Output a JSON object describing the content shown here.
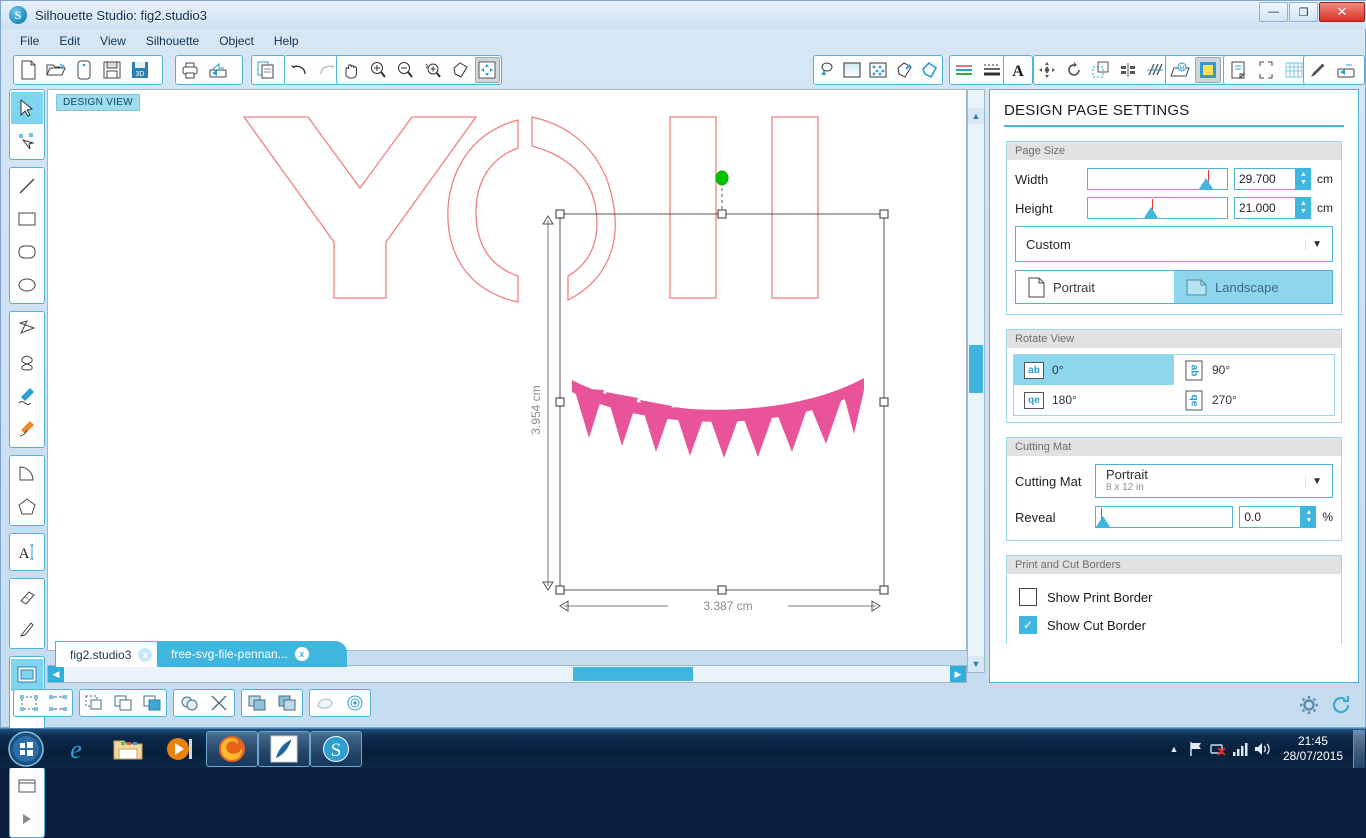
{
  "window": {
    "title": "Silhouette Studio: fig2.studio3",
    "logo_letter": "S",
    "minimize": "—",
    "maximize": "❐",
    "close": "✕"
  },
  "menubar": {
    "items": [
      {
        "label": "File"
      },
      {
        "label": "Edit"
      },
      {
        "label": "View"
      },
      {
        "label": "Silhouette"
      },
      {
        "label": "Object"
      },
      {
        "label": "Help"
      }
    ]
  },
  "toolbar": {
    "groups": [
      {
        "name": "file-group",
        "buttons": [
          {
            "icon": "new-document-icon"
          },
          {
            "icon": "open-folder-icon"
          },
          {
            "icon": "open-recent-icon"
          },
          {
            "icon": "save-icon"
          },
          {
            "icon": "save-to-library-icon"
          }
        ]
      },
      {
        "name": "print-group",
        "buttons": [
          {
            "icon": "print-icon"
          },
          {
            "icon": "send-to-silhouette-icon"
          }
        ]
      },
      {
        "name": "clipboard-group",
        "buttons": [
          {
            "icon": "copy-icon"
          },
          {
            "icon": "paste-icon"
          },
          {
            "icon": "cut-scissors-icon"
          }
        ]
      },
      {
        "name": "undo-group",
        "buttons": [
          {
            "icon": "undo-icon"
          },
          {
            "icon": "redo-icon"
          }
        ]
      },
      {
        "name": "view-group",
        "buttons": [
          {
            "icon": "pan-hand-icon"
          },
          {
            "icon": "zoom-in-icon"
          },
          {
            "icon": "zoom-out-icon"
          },
          {
            "icon": "zoom-selection-icon"
          },
          {
            "icon": "zoom-region-icon"
          },
          {
            "icon": "fit-to-window-icon"
          }
        ]
      },
      {
        "name": "panel-group-1",
        "buttons": [
          {
            "icon": "fill-color-icon"
          },
          {
            "icon": "gradient-fill-icon"
          },
          {
            "icon": "pattern-fill-icon"
          },
          {
            "icon": "line-color-icon"
          },
          {
            "icon": "line-style-icon"
          }
        ]
      },
      {
        "name": "panel-group-2",
        "buttons": [
          {
            "icon": "sketch-pens-icon"
          },
          {
            "icon": "line-thickness-icon"
          }
        ]
      },
      {
        "name": "text-group",
        "buttons": [
          {
            "icon": "text-style-icon"
          }
        ]
      },
      {
        "name": "transform-group",
        "buttons": [
          {
            "icon": "transform-icon"
          },
          {
            "icon": "rotate-icon"
          },
          {
            "icon": "scale-icon"
          },
          {
            "icon": "align-icon"
          },
          {
            "icon": "replicate-icon"
          }
        ]
      },
      {
        "name": "modify-group",
        "buttons": [
          {
            "icon": "mat-settings-icon"
          },
          {
            "icon": "cut-settings-icon"
          }
        ]
      },
      {
        "name": "page-group",
        "buttons": [
          {
            "icon": "design-page-settings-icon"
          },
          {
            "icon": "registration-marks-icon"
          },
          {
            "icon": "grid-icon"
          }
        ]
      },
      {
        "name": "send-group",
        "buttons": [
          {
            "icon": "pen-holder-icon"
          },
          {
            "icon": "send-icon"
          }
        ]
      }
    ]
  },
  "left_rail": {
    "groups": [
      {
        "tools": [
          {
            "icon": "select-arrow-icon",
            "selected": true
          },
          {
            "icon": "edit-points-icon",
            "selected": false
          }
        ]
      },
      {
        "tools": [
          {
            "icon": "line-tool-icon",
            "selected": false
          },
          {
            "icon": "rectangle-tool-icon",
            "selected": false
          },
          {
            "icon": "rounded-rectangle-tool-icon",
            "selected": false
          },
          {
            "icon": "ellipse-tool-icon",
            "selected": false
          }
        ]
      },
      {
        "tools": [
          {
            "icon": "polygon-tool-icon",
            "selected": false
          },
          {
            "icon": "curve-tool-icon",
            "selected": false
          },
          {
            "icon": "draw-freehand-icon",
            "selected": false
          },
          {
            "icon": "draw-smooth-icon",
            "selected": false
          }
        ]
      },
      {
        "tools": [
          {
            "icon": "arc-tool-icon",
            "selected": false
          },
          {
            "icon": "regular-polygon-tool-icon",
            "selected": false
          }
        ]
      },
      {
        "tools": [
          {
            "icon": "text-tool-icon",
            "selected": false
          }
        ]
      },
      {
        "tools": [
          {
            "icon": "eraser-tool-icon",
            "selected": false
          },
          {
            "icon": "knife-tool-icon",
            "selected": false
          }
        ]
      },
      {
        "tools": [
          {
            "icon": "design-page-icon",
            "selected": true
          },
          {
            "icon": "library-icon",
            "selected": false
          },
          {
            "icon": "store-icon",
            "selected": false
          }
        ]
      },
      {
        "tools": [
          {
            "icon": "panel-toggle-icon",
            "selected": false
          },
          {
            "icon": "expand-arrow-icon",
            "selected": false
          }
        ]
      }
    ]
  },
  "canvas": {
    "badge": "DESIGN VIEW",
    "letters": "YOU",
    "selection": {
      "height_label": "3.954 cm",
      "width_label": "3.387 cm"
    },
    "shape_color": "#e8748a",
    "pennant_color": "#e8539a",
    "rotate_handle_color": "#00c400"
  },
  "tabs": {
    "items": [
      {
        "label": "fig2.studio3",
        "active": true,
        "close": "x"
      },
      {
        "label": "free-svg-file-pennan...",
        "active": false,
        "close": "x"
      }
    ]
  },
  "bottom_toolbar": {
    "groups": [
      {
        "buttons": [
          {
            "icon": "group-icon"
          },
          {
            "icon": "ungroup-icon"
          }
        ]
      },
      {
        "buttons": [
          {
            "icon": "make-compound-path-icon"
          },
          {
            "icon": "bring-to-front-icon"
          },
          {
            "icon": "send-to-back-icon"
          }
        ]
      },
      {
        "buttons": [
          {
            "icon": "weld-icon"
          },
          {
            "icon": "detach-lines-icon"
          }
        ]
      },
      {
        "buttons": [
          {
            "icon": "duplicate-icon"
          },
          {
            "icon": "replicate-icon"
          }
        ]
      },
      {
        "buttons": [
          {
            "icon": "offset-icon"
          },
          {
            "icon": "internal-offset-icon"
          }
        ]
      }
    ],
    "right_buttons": [
      {
        "icon": "settings-gear-icon"
      },
      {
        "icon": "sync-refresh-icon"
      }
    ]
  },
  "panel": {
    "title": "DESIGN PAGE SETTINGS",
    "page_size": {
      "section_label": "Page Size",
      "width_label": "Width",
      "width_value": "29.700",
      "width_unit": "cm",
      "height_label": "Height",
      "height_value": "21.000",
      "height_unit": "cm",
      "preset": "Custom",
      "orientation": {
        "portrait": "Portrait",
        "landscape": "Landscape",
        "selected": "Landscape"
      }
    },
    "rotate_view": {
      "section_label": "Rotate View",
      "options": [
        {
          "label": "0°",
          "glyph": "ab",
          "selected": true
        },
        {
          "label": "90°",
          "glyph": "ab",
          "selected": false
        },
        {
          "label": "180°",
          "glyph": "qe",
          "selected": false
        },
        {
          "label": "270°",
          "glyph": "qe",
          "selected": false
        }
      ]
    },
    "cutting_mat": {
      "section_label": "Cutting Mat",
      "label": "Cutting Mat",
      "value": "Portrait",
      "value_sub": "8 x 12 in",
      "reveal_label": "Reveal",
      "reveal_value": "0.0",
      "reveal_unit": "%"
    },
    "print_cut": {
      "section_label": "Print and Cut Borders",
      "show_print_border": {
        "label": "Show Print Border",
        "checked": false
      },
      "show_cut_border": {
        "label": "Show Cut Border",
        "checked": true,
        "check": "✓"
      }
    }
  },
  "taskbar": {
    "start": "start-orb-icon",
    "items": [
      {
        "icon": "internet-explorer-icon",
        "pinned": false
      },
      {
        "icon": "file-explorer-icon",
        "pinned": false
      },
      {
        "icon": "media-player-icon",
        "pinned": false
      },
      {
        "icon": "firefox-icon",
        "pinned": true
      },
      {
        "icon": "feather-editor-icon",
        "pinned": true
      },
      {
        "icon": "silhouette-studio-icon",
        "pinned": true
      }
    ],
    "tray": {
      "show_hidden": "▲",
      "icons": [
        "action-center-flag-icon",
        "network-icon",
        "volume-icon",
        "signal-icon"
      ],
      "time": "21:45",
      "date": "28/07/2015"
    }
  }
}
